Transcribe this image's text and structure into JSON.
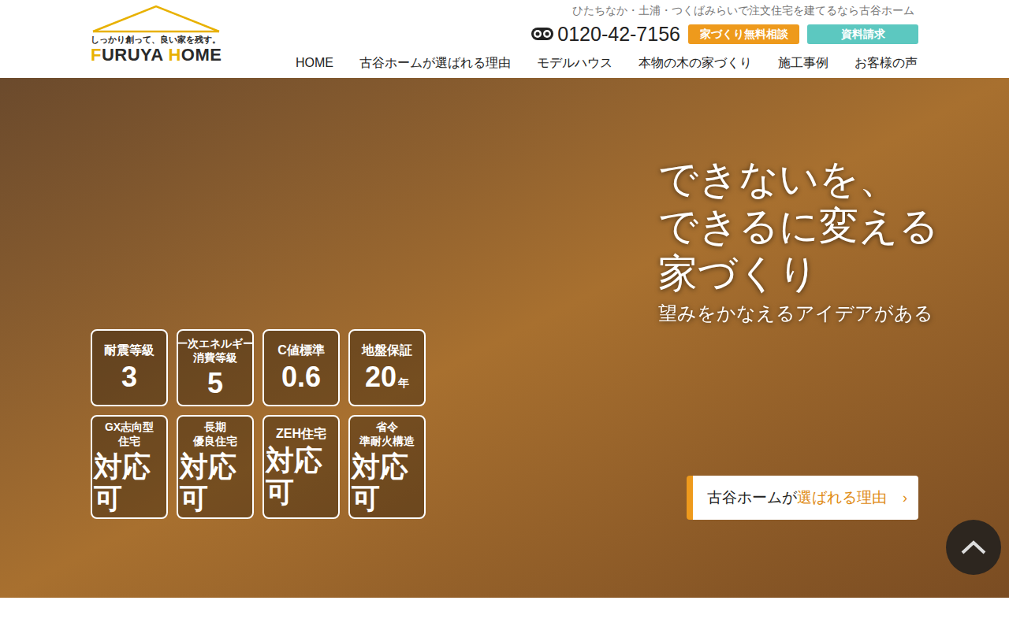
{
  "header": {
    "logo": {
      "tagline": "しっかり創って、良い家を残す。",
      "name_parts": [
        {
          "text": "F",
          "color": "#e8b100"
        },
        {
          "text": "URUYA ",
          "color": "#2a2a2a"
        },
        {
          "text": "H",
          "color": "#e8b100"
        },
        {
          "text": "OME",
          "color": "#2a2a2a"
        }
      ]
    },
    "top_text": "ひたちなか・土浦・つくばみらいで注文住宅を建てるなら古谷ホーム",
    "phone": "0120-42-7156",
    "buttons": [
      {
        "label": "家づくり無料相談",
        "color": "#ee9a1c"
      },
      {
        "label": "資料請求",
        "color": "#5cc8c0"
      }
    ],
    "nav": [
      "HOME",
      "古谷ホームが選ばれる理由",
      "モデルハウス",
      "本物の木の家づくり",
      "施工事例",
      "お客様の声"
    ]
  },
  "hero": {
    "headline": [
      "できないを、",
      "できるに変える",
      "家づくり"
    ],
    "subtitle": "望みをかなえるアイデアがある",
    "badges": [
      {
        "label": [
          "耐震等級"
        ],
        "value": "3",
        "unit": ""
      },
      {
        "label": [
          "一次エネルギー",
          "消費等級"
        ],
        "value": "5",
        "unit": ""
      },
      {
        "label": [
          "C値標準"
        ],
        "value": "0.6",
        "unit": ""
      },
      {
        "label": [
          "地盤保証"
        ],
        "value": "20",
        "unit": "年"
      },
      {
        "label": [
          "GX志向型",
          "住宅"
        ],
        "value": "対応可",
        "unit": ""
      },
      {
        "label": [
          "長期",
          "優良住宅"
        ],
        "value": "対応可",
        "unit": ""
      },
      {
        "label": [
          "ZEH住宅"
        ],
        "value": "対応可",
        "unit": ""
      },
      {
        "label": [
          "省令",
          "準耐火構造"
        ],
        "value": "対応可",
        "unit": ""
      }
    ],
    "cta": {
      "prefix": "古谷ホームが",
      "accent": "選ばれる理由",
      "arrow": "›"
    }
  }
}
